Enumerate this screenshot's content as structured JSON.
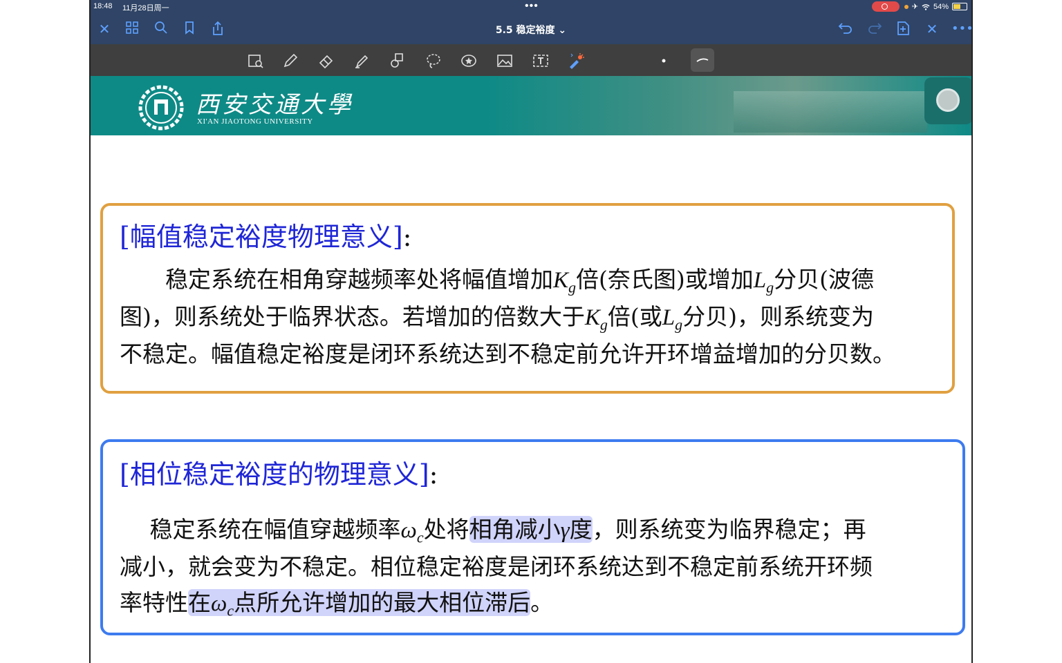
{
  "status": {
    "time": "18:48",
    "date": "11月28日周一",
    "dots": "•••",
    "battery": "54%"
  },
  "nav": {
    "title": "5.5 稳定裕度 ⌄"
  },
  "banner": {
    "name_cn": "西安交通大學",
    "name_en": "XI'AN JIAOTONG UNIVERSITY"
  },
  "box1": {
    "title": "[幅值稳定裕度物理意义]",
    "title_colon": ":",
    "lines": [
      "　　稳定系统在相角穿越频率处将幅值增加K",
      "图)，则系统处于临界状态。若增加的倍数大于K",
      "不稳定。幅值稳定裕度是闭环系统达到不稳定前允许开环增益增加的分贝数。"
    ],
    "line1_parts": [
      "　　稳定系统在相角穿越频率处将幅值增加",
      "K",
      "g",
      "倍(奈氏图)或增加",
      "L",
      "g",
      "分贝(波德"
    ],
    "line2_parts": [
      "图)，则系统处于临界状态。若增加的倍数大于",
      "K",
      "g",
      "倍(或",
      "L",
      "g",
      "分贝)，则系统变为"
    ],
    "line3": "不稳定。幅值稳定裕度是闭环系统达到不稳定前允许开环增益增加的分贝数。"
  },
  "box2": {
    "title": "[相位稳定裕度的物理意义]",
    "title_colon": ":",
    "line1_parts": [
      "　 稳定系统在幅值穿越频率",
      "ω",
      "c",
      "处将",
      "相角减小",
      "γ",
      "度",
      "，则系统变为临界稳定；再"
    ],
    "line2": "减小，就会变为不稳定。相位稳定裕度是闭环系统达到不稳定前系统开环频",
    "line3_parts": [
      "率特性",
      "在",
      "ω",
      "c",
      "点所允许增加的最大相位滞后",
      "。"
    ]
  }
}
